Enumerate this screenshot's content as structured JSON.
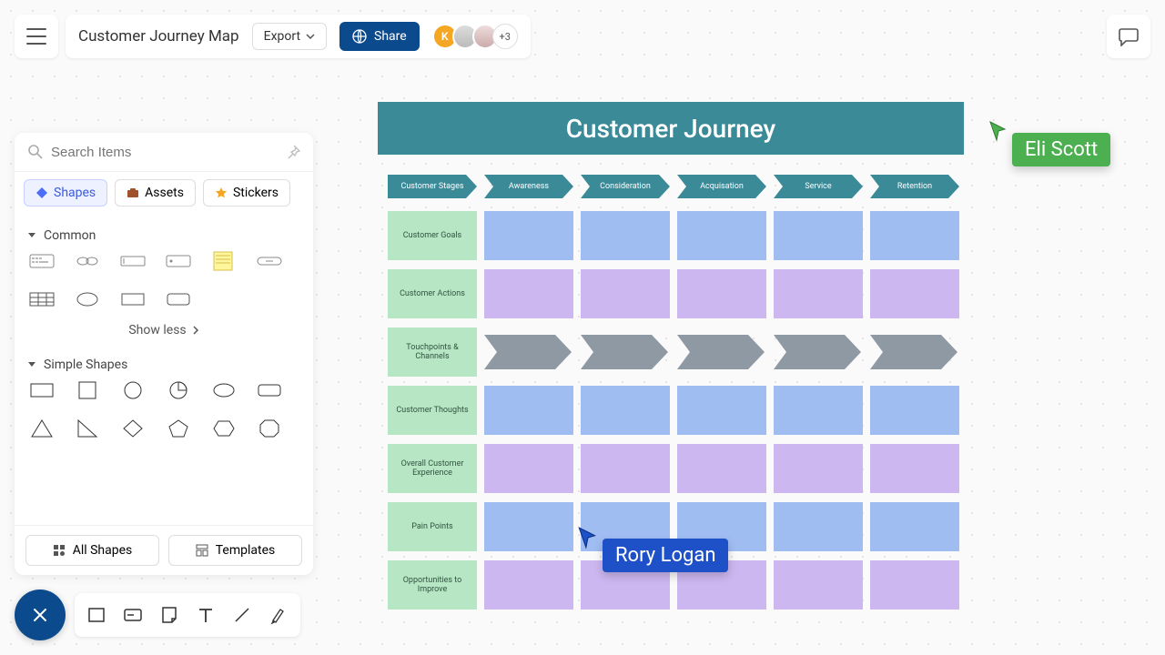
{
  "topbar": {
    "doc_title": "Customer Journey Map",
    "export_label": "Export",
    "share_label": "Share",
    "avatar_initial": "K",
    "more_count": "+3"
  },
  "panel": {
    "search_placeholder": "Search Items",
    "tabs": {
      "shapes": "Shapes",
      "assets": "Assets",
      "stickers": "Stickers"
    },
    "group_common": "Common",
    "show_less": "Show less",
    "group_simple": "Simple Shapes",
    "footer": {
      "all_shapes": "All Shapes",
      "templates": "Templates"
    }
  },
  "canvas": {
    "title": "Customer Journey",
    "stages": [
      "Customer Stages",
      "Awareness",
      "Consideration",
      "Acquisation",
      "Service",
      "Retention"
    ],
    "row_labels": [
      "Customer Goals",
      "Customer Actions",
      "Touchpoints & Channels",
      "Customer Thoughts",
      "Overall Customer Experience",
      "Pain Points",
      "Opportunities to Improve"
    ],
    "row_styles": [
      "blue",
      "purple",
      "arrow",
      "blue",
      "purple",
      "blue",
      "purple"
    ]
  },
  "cursors": {
    "green": "Eli Scott",
    "blue": "Rory Logan"
  },
  "colors": {
    "arrow_head": "#3a8a98",
    "arrow_gray": "#8f99a3"
  }
}
